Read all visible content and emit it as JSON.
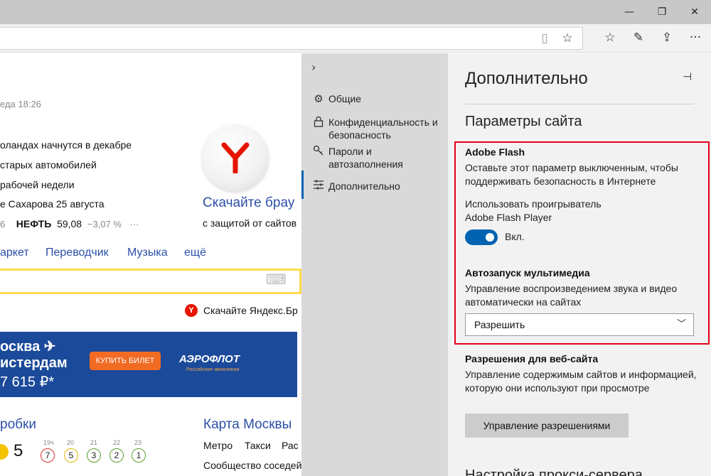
{
  "window": {
    "minimize_icon": "—",
    "restore_icon": "❐",
    "close_icon": "✕"
  },
  "toolbar": {
    "reading_view_icon": "▯",
    "favorite_star_icon": "☆",
    "favorites_list_icon": "☆",
    "notes_icon": "✎",
    "share_icon": "⇪",
    "more_icon": "···"
  },
  "page": {
    "time": "еда 18:26",
    "news": [
      "оландах начнутся в декабре",
      "старых автомобилей",
      "рабочей недели",
      "е Сахарова 25 августа"
    ],
    "oil_prefix": "6",
    "oil_label": "НЕФТЬ",
    "oil_value": "59,08",
    "oil_change": "−3,07 %",
    "oil_more": "···",
    "download_title": "Скачайте брау",
    "download_sub": "с защитой от сайтов",
    "services": [
      "аркет",
      "Переводчик",
      "Музыка",
      "ещё"
    ],
    "keyboard_icon": "⌨",
    "yandex_download": "Скачайте Яндекс.Бр",
    "banner": {
      "line1": "осква ✈",
      "line2": "истердам",
      "price": "7 615 ₽*",
      "button": "КУПИТЬ БИЛЕТ",
      "airline": "АЭРОФЛОТ",
      "airline_sub": "Российские авиалинии"
    },
    "traffic_title": "робки",
    "traffic_level": "5",
    "traffic_hours": [
      "19ч",
      "20",
      "21",
      "22",
      "23"
    ],
    "traffic_values": [
      "7",
      "5",
      "3",
      "2",
      "1"
    ],
    "map_title": "Карта Москвы",
    "map_links": [
      "Метро",
      "Такси",
      "Рас"
    ],
    "map_more": "Сообщество соседей"
  },
  "nav": {
    "back_icon": "›",
    "items": [
      {
        "icon": "⚙",
        "label": "Общие"
      },
      {
        "icon": "🔒",
        "label": "Конфиденциальность и безопасность"
      },
      {
        "icon": "🔑",
        "label": "Пароли и автозаполнения"
      },
      {
        "icon": "☰",
        "label": "Дополнительно"
      }
    ]
  },
  "pane": {
    "title": "Дополнительно",
    "pin_icon": "⊣",
    "section_title": "Параметры сайта",
    "flash_head": "Adobe Flash",
    "flash_desc": "Оставьте этот параметр выключенным, чтобы поддерживать безопасность в Интернете",
    "flash_toggle_desc": "Использовать проигрыватель Adobe Flash Player",
    "flash_toggle_state": "Вкл.",
    "flash_enabled": true,
    "autoplay_head": "Автозапуск мультимедиа",
    "autoplay_desc": "Управление воспроизведением звука и видео автоматически на сайтах",
    "autoplay_value": "Разрешить",
    "autoplay_chevron": "﹀",
    "permissions_head": "Разрешения для веб-сайта",
    "permissions_desc": "Управление содержимым сайтов и информацией, которую они используют при просмотре",
    "manage_button": "Управление разрешениями",
    "proxy_title": "Настройка прокси-сервера"
  },
  "colors": {
    "accent": "#0063b1",
    "highlight": "#e3001b",
    "yandex_red": "#e61400",
    "banner": "#1b4a9a",
    "buy_button": "#f26b23"
  }
}
